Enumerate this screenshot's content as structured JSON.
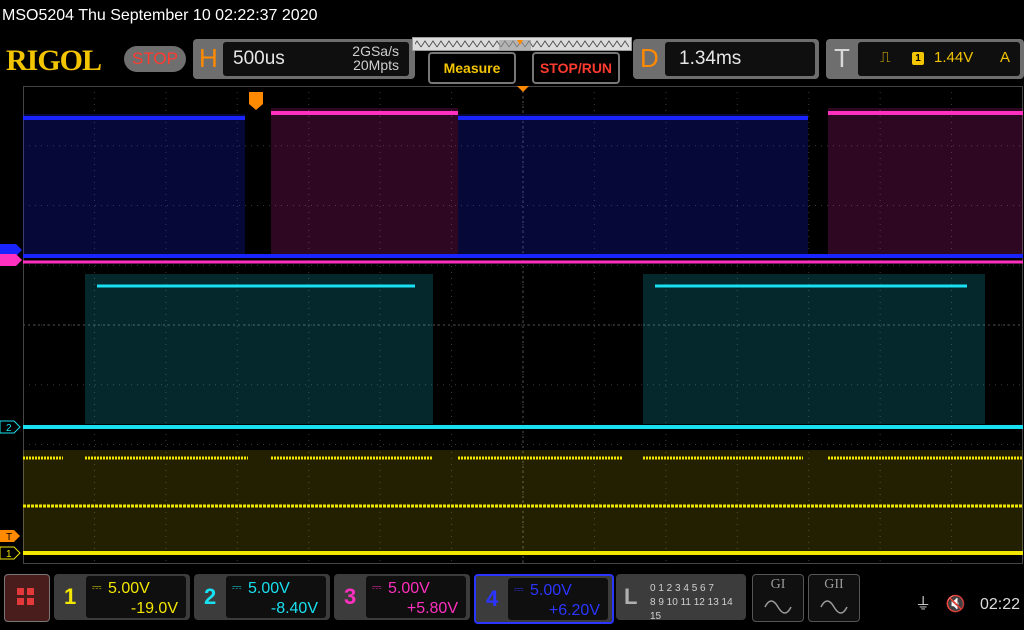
{
  "window": {
    "title": "MSO5204  Thu September 10 02:22:37 2020"
  },
  "header": {
    "logo": "RIGOL",
    "run_state": "STOP",
    "horizontal": {
      "letter": "H",
      "timebase": "500us",
      "sample_rate": "2GSa/s",
      "memory_depth": "20Mpts"
    },
    "measure_label": "Measure",
    "stop_run_label": "STOP/RUN",
    "delay": {
      "letter": "D",
      "value": "1.34ms"
    },
    "trigger": {
      "letter": "T",
      "edge_icon": "rising-edge-icon",
      "source": "1",
      "level": "1.44V",
      "mode": "A"
    }
  },
  "channels": [
    {
      "num": "1",
      "scale": "5.00V",
      "offset": "-19.0V",
      "color": "#f3e600"
    },
    {
      "num": "2",
      "scale": "5.00V",
      "offset": "-8.40V",
      "color": "#18e0f0"
    },
    {
      "num": "3",
      "scale": "5.00V",
      "offset": "+5.80V",
      "color": "#ff2fbf"
    },
    {
      "num": "4",
      "scale": "5.00V",
      "offset": "+6.20V",
      "color": "#1a24ff"
    }
  ],
  "logic": {
    "label": "L",
    "row1": "0 1 2 3  4 5 6 7",
    "row2": "8 9 10 11 12 13 14 15"
  },
  "gen": [
    {
      "label": "GI"
    },
    {
      "label": "GII"
    }
  ],
  "status": {
    "usb_icon": "usb-icon",
    "speaker_icon": "speaker-muted-icon",
    "time": "02:22"
  },
  "markers": {
    "trigger_pos": "T",
    "ch2_label": "2",
    "ch1_label": "1",
    "trig_level": "T"
  }
}
